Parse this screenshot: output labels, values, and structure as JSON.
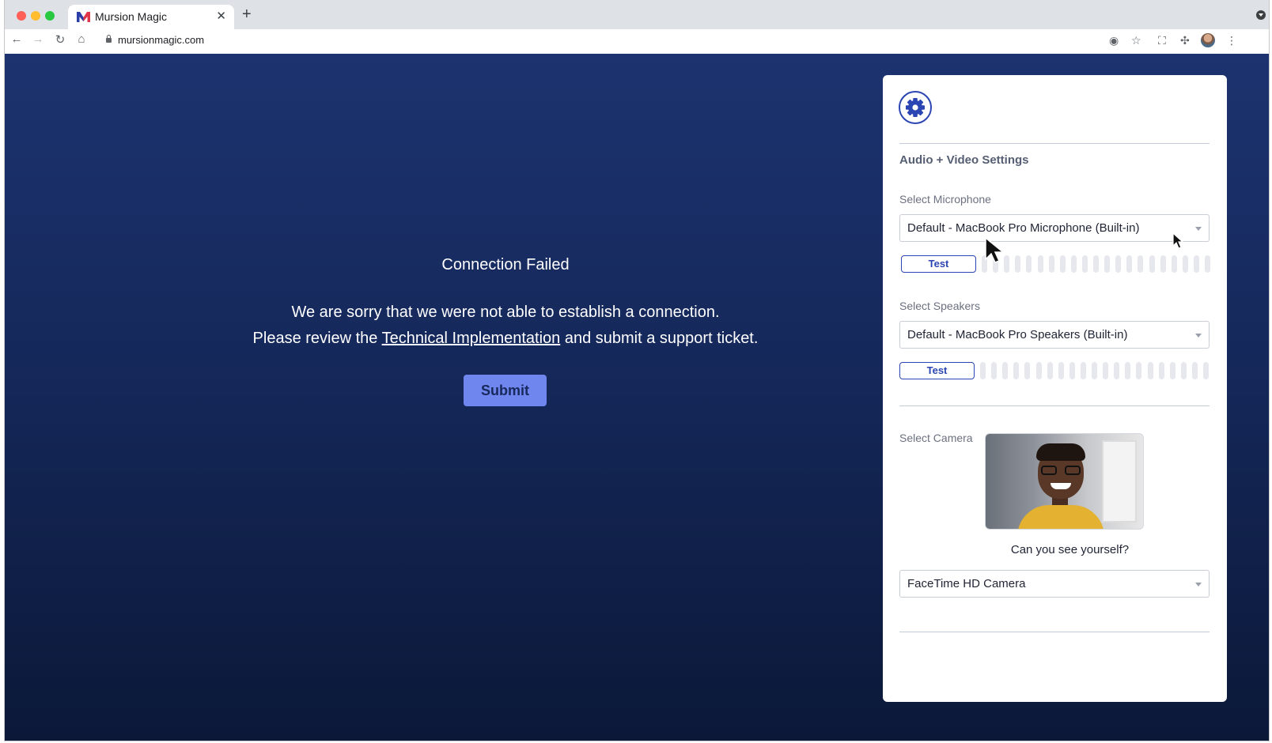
{
  "browser": {
    "tab_title": "Mursion Magic",
    "tab_close": "✕",
    "new_tab": "+",
    "url": "mursionmagic.com"
  },
  "error": {
    "title": "Connection Failed",
    "line1": "We are sorry that we were not able to establish a connection.",
    "line2_prefix": "Please review the ",
    "link_text": "Technical Implementation",
    "line2_suffix": " and submit a support ticket.",
    "submit_label": "Submit"
  },
  "settings": {
    "title": "Audio + Video Settings",
    "microphone": {
      "label": "Select Microphone",
      "value": "Default - MacBook Pro Microphone (Built-in)",
      "test_label": "Test",
      "level": 0
    },
    "speakers": {
      "label": "Select Speakers",
      "value": "Default - MacBook Pro Speakers (Built-in)",
      "test_label": "Test",
      "level": 0
    },
    "camera": {
      "label": "Select Camera",
      "caption": "Can you see yourself?",
      "value": "FaceTime HD Camera"
    }
  },
  "colors": {
    "accent": "#2b45b2",
    "submit_bg": "#6f86ef",
    "page_bg_top": "#1c3370",
    "page_bg_bottom": "#0b1838"
  }
}
